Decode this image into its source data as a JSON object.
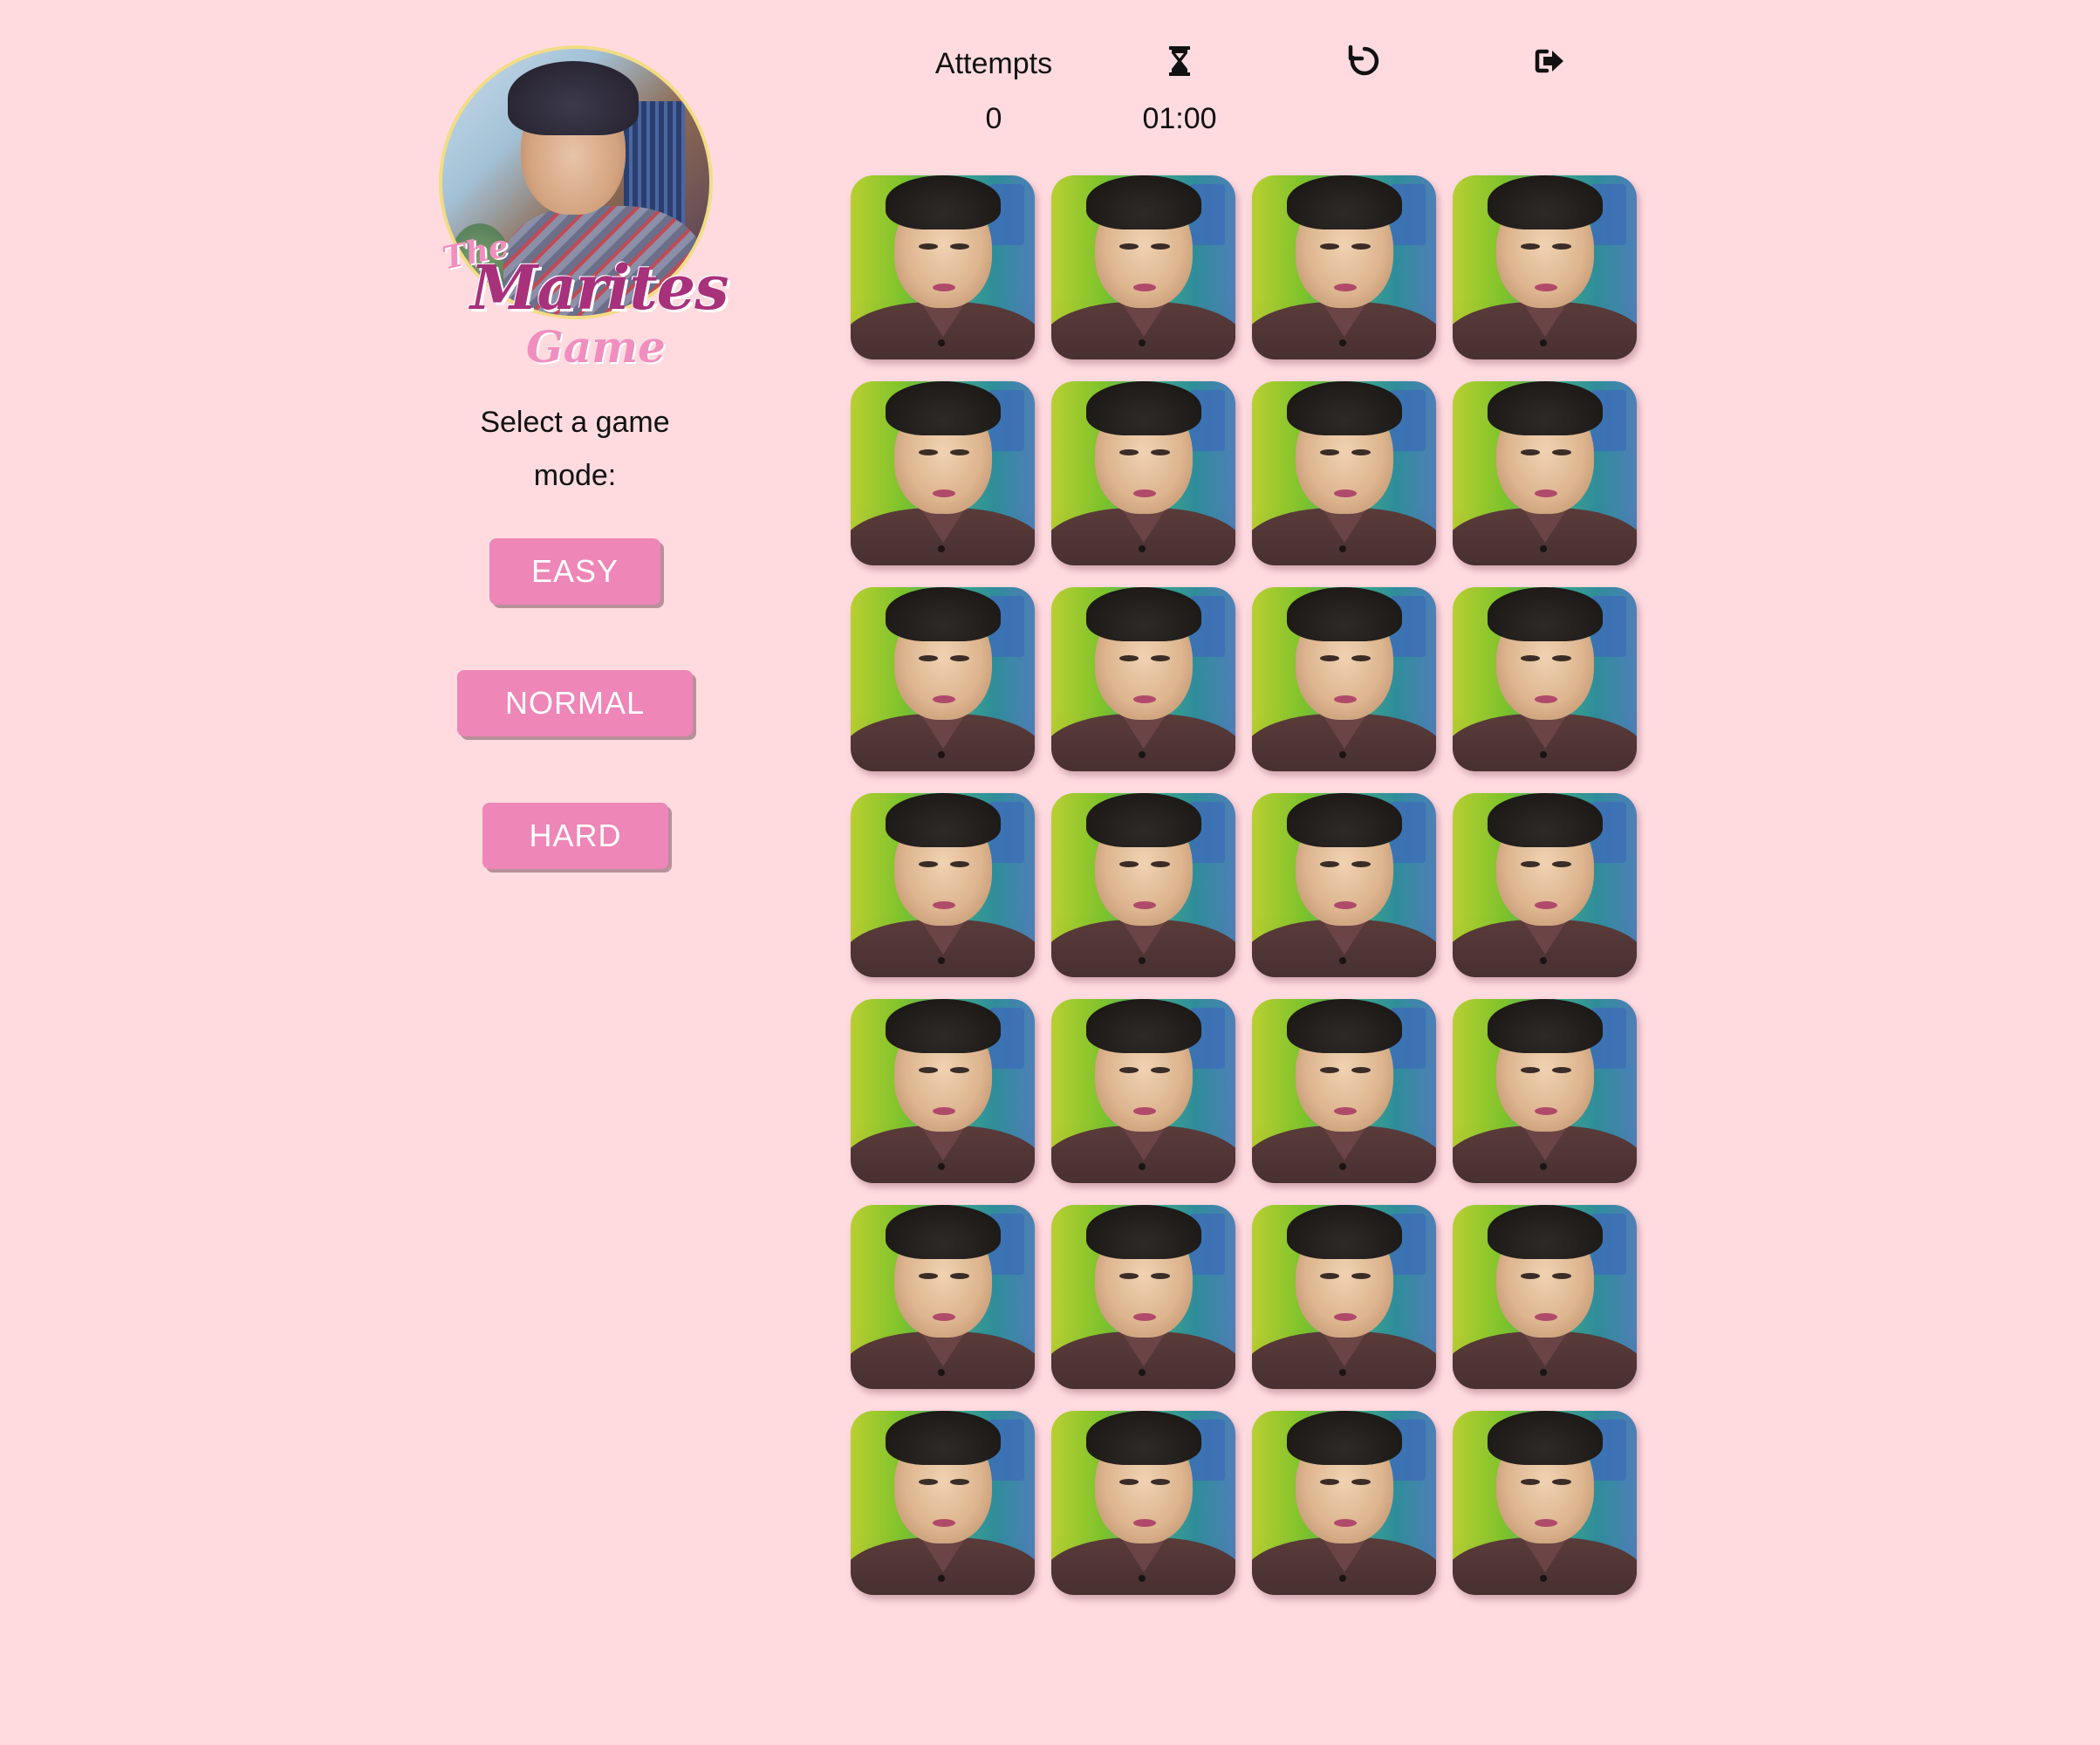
{
  "logo": {
    "the": "The",
    "marites": "Marites",
    "game": "Game"
  },
  "mode_label": "Select a game mode:",
  "modes": {
    "easy": "EASY",
    "normal": "NORMAL",
    "hard": "HARD"
  },
  "stats": {
    "attempts_label": "Attempts",
    "attempts_value": "0",
    "timer_icon": "hourglass-icon",
    "timer_value": "01:00"
  },
  "controls": {
    "restart_icon": "restart-icon",
    "exit_icon": "exit-icon"
  },
  "board": {
    "rows": 7,
    "columns": 4,
    "card_state": "face-down"
  },
  "colors": {
    "background": "#ffdbe0",
    "button": "#ee86b7",
    "button_text": "#ffffff",
    "logo_primary": "#a8317c",
    "logo_secondary": "#f08fbf"
  }
}
